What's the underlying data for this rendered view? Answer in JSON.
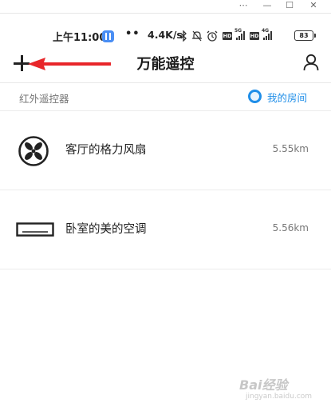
{
  "window_controls": [
    "⋯",
    "—",
    "☐",
    "✕"
  ],
  "status_bar": {
    "time": "上午11:00",
    "dots": "••",
    "net_speed": "4.4K/s",
    "battery": "83",
    "network_tags": [
      "HD",
      "5G",
      "HD",
      "4G"
    ],
    "icons": [
      "app-icon",
      "bluetooth-icon",
      "mute-bell-icon",
      "alarm-icon",
      "signal-icon",
      "battery-icon"
    ]
  },
  "header": {
    "title": "万能遥控",
    "left_icon": "plus-icon",
    "right_icon": "user-icon",
    "annotation": "red-arrow-pointing-left",
    "arrow_color": "#e8262a"
  },
  "subbar": {
    "label": "红外遥控器",
    "room_button": "我的房间",
    "accent_color": "#1f8ee8"
  },
  "devices": [
    {
      "name": "客厅的格力风扇",
      "distance": "5.55km",
      "icon": "fan-icon"
    },
    {
      "name": "卧室的美的空调",
      "distance": "5.56km",
      "icon": "air-conditioner-icon"
    }
  ],
  "watermark": {
    "brand": "Bai经验",
    "url": "jingyan.baidu.com"
  }
}
